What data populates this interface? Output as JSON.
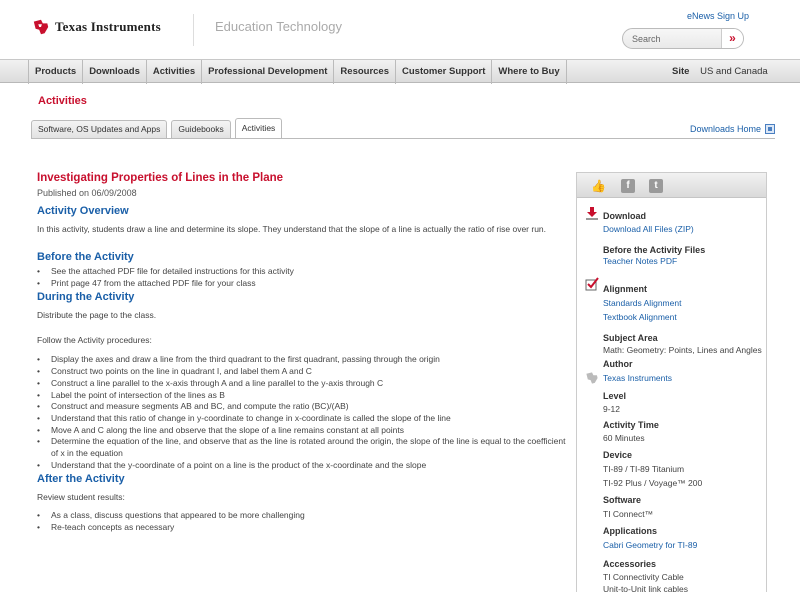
{
  "header": {
    "brand": "Texas Instruments",
    "section": "Education Technology",
    "enews": "eNews Sign Up",
    "search_placeholder": "Search",
    "search_btn": "»"
  },
  "nav": {
    "items": [
      "Products",
      "Downloads",
      "Activities",
      "Professional Development",
      "Resources",
      "Customer Support",
      "Where to Buy"
    ],
    "site_label": "Site",
    "site_value": "US and Canada"
  },
  "page": {
    "title": "Activities",
    "tabs": [
      "Software, OS Updates and Apps",
      "Guidebooks",
      "Activities"
    ],
    "downloads_home": "Downloads Home"
  },
  "article": {
    "title": "Investigating Properties of Lines in the Plane",
    "published": "Published on 06/09/2008",
    "overview_h": "Activity Overview",
    "overview_p": "In this activity, students draw a line and determine its slope. They understand that the slope of a line is actually the ratio of rise over run.",
    "before_h": "Before the Activity",
    "before_items": [
      "See the attached PDF file for detailed instructions for this activity",
      "Print page 47 from the attached PDF file for your class"
    ],
    "during_h": "During the Activity",
    "during_p1": "Distribute the page to the class.",
    "during_p2": "Follow the Activity procedures:",
    "during_items": [
      "Display the axes and draw a line from the third quadrant to the first quadrant, passing through the origin",
      "Construct two points on the line in quadrant I, and label them A and C",
      "Construct a line parallel to the x-axis through A and a line parallel to the y-axis through C",
      "Label the point of intersection of the lines as B",
      "Construct and measure segments AB and BC, and compute the ratio (BC)/(AB)",
      "Understand that this ratio of change in y-coordinate to change in x-coordinate is called the slope of the line",
      "Move A and C along the line and observe that the slope of a line remains constant at all points",
      "Determine the equation of the line, and observe that as the line is rotated around the origin, the slope of the line is equal to the coefficient of x in the equation",
      "Understand that the y-coordinate of a point on a line is the product of the x-coordinate and the slope"
    ],
    "after_h": "After the Activity",
    "after_p": "Review student results:",
    "after_items": [
      "As a class, discuss questions that appeared to be more challenging",
      "Re-teach concepts as necessary"
    ]
  },
  "sidebar": {
    "download_h": "Download",
    "download_all": "Download All Files (ZIP)",
    "before_files_h": "Before the Activity Files",
    "teacher_notes": "Teacher Notes PDF",
    "alignment_h": "Alignment",
    "standards": "Standards Alignment",
    "textbook": "Textbook Alignment",
    "subject_h": "Subject Area",
    "subject": "Math: Geometry: Points, Lines and Angles",
    "author_h": "Author",
    "author": "Texas Instruments",
    "level_h": "Level",
    "level": "9-12",
    "time_h": "Activity Time",
    "time": "60 Minutes",
    "device_h": "Device",
    "device1": "TI-89 / TI-89 Titanium",
    "device2": "TI-92 Plus / Voyage™ 200",
    "software_h": "Software",
    "software": "TI Connect™",
    "apps_h": "Applications",
    "app": "Cabri Geometry for TI-89",
    "accessories_h": "Accessories",
    "acc1": "TI Connectivity Cable",
    "acc2": "Unit-to-Unit link cables"
  }
}
